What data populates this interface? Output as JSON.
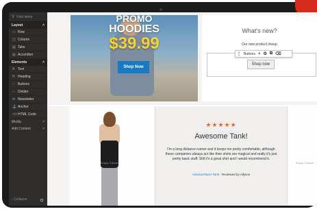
{
  "sidebar": {
    "search_placeholder": "Find items",
    "groups": [
      {
        "label": "Layout",
        "items": [
          "Row",
          "Column",
          "Tabs",
          "Accordion"
        ]
      },
      {
        "label": "Elements",
        "items": [
          "Text",
          "Heading",
          "Buttons",
          "Divider",
          "Newsletter",
          "Anchor",
          "HTML Code"
        ]
      }
    ],
    "collapsed_groups": [
      "Media",
      "Add Content"
    ],
    "collapse_label": "Collapse"
  },
  "promo": {
    "line1": "PROMO",
    "line2": "HOODIES",
    "price": "$39.99",
    "button": "Shop Now"
  },
  "whats_new": {
    "title": "What's new?",
    "subtitle": "Our new product lineup",
    "toolbar_label": "Buttons",
    "button": "Shop now"
  },
  "review": {
    "stars": "★★★★★",
    "title": "Awesome Tank!",
    "body": "I'm a long distance runner and it keeps me pretty comfortable, although these companies always act like their shirts are magical and really it's just pretty basic stuff. Still it's a great shirt and I would recommend it.",
    "product_link": "Antonia Racer Tank",
    "reviewer": "- Reviewed by Allyson"
  },
  "placeholders": {
    "empty_column": "Empty Column"
  },
  "colors": {
    "accent_blue": "#1979c3",
    "star_orange": "#f26322",
    "sidebar_bg": "#2f2d2c"
  }
}
